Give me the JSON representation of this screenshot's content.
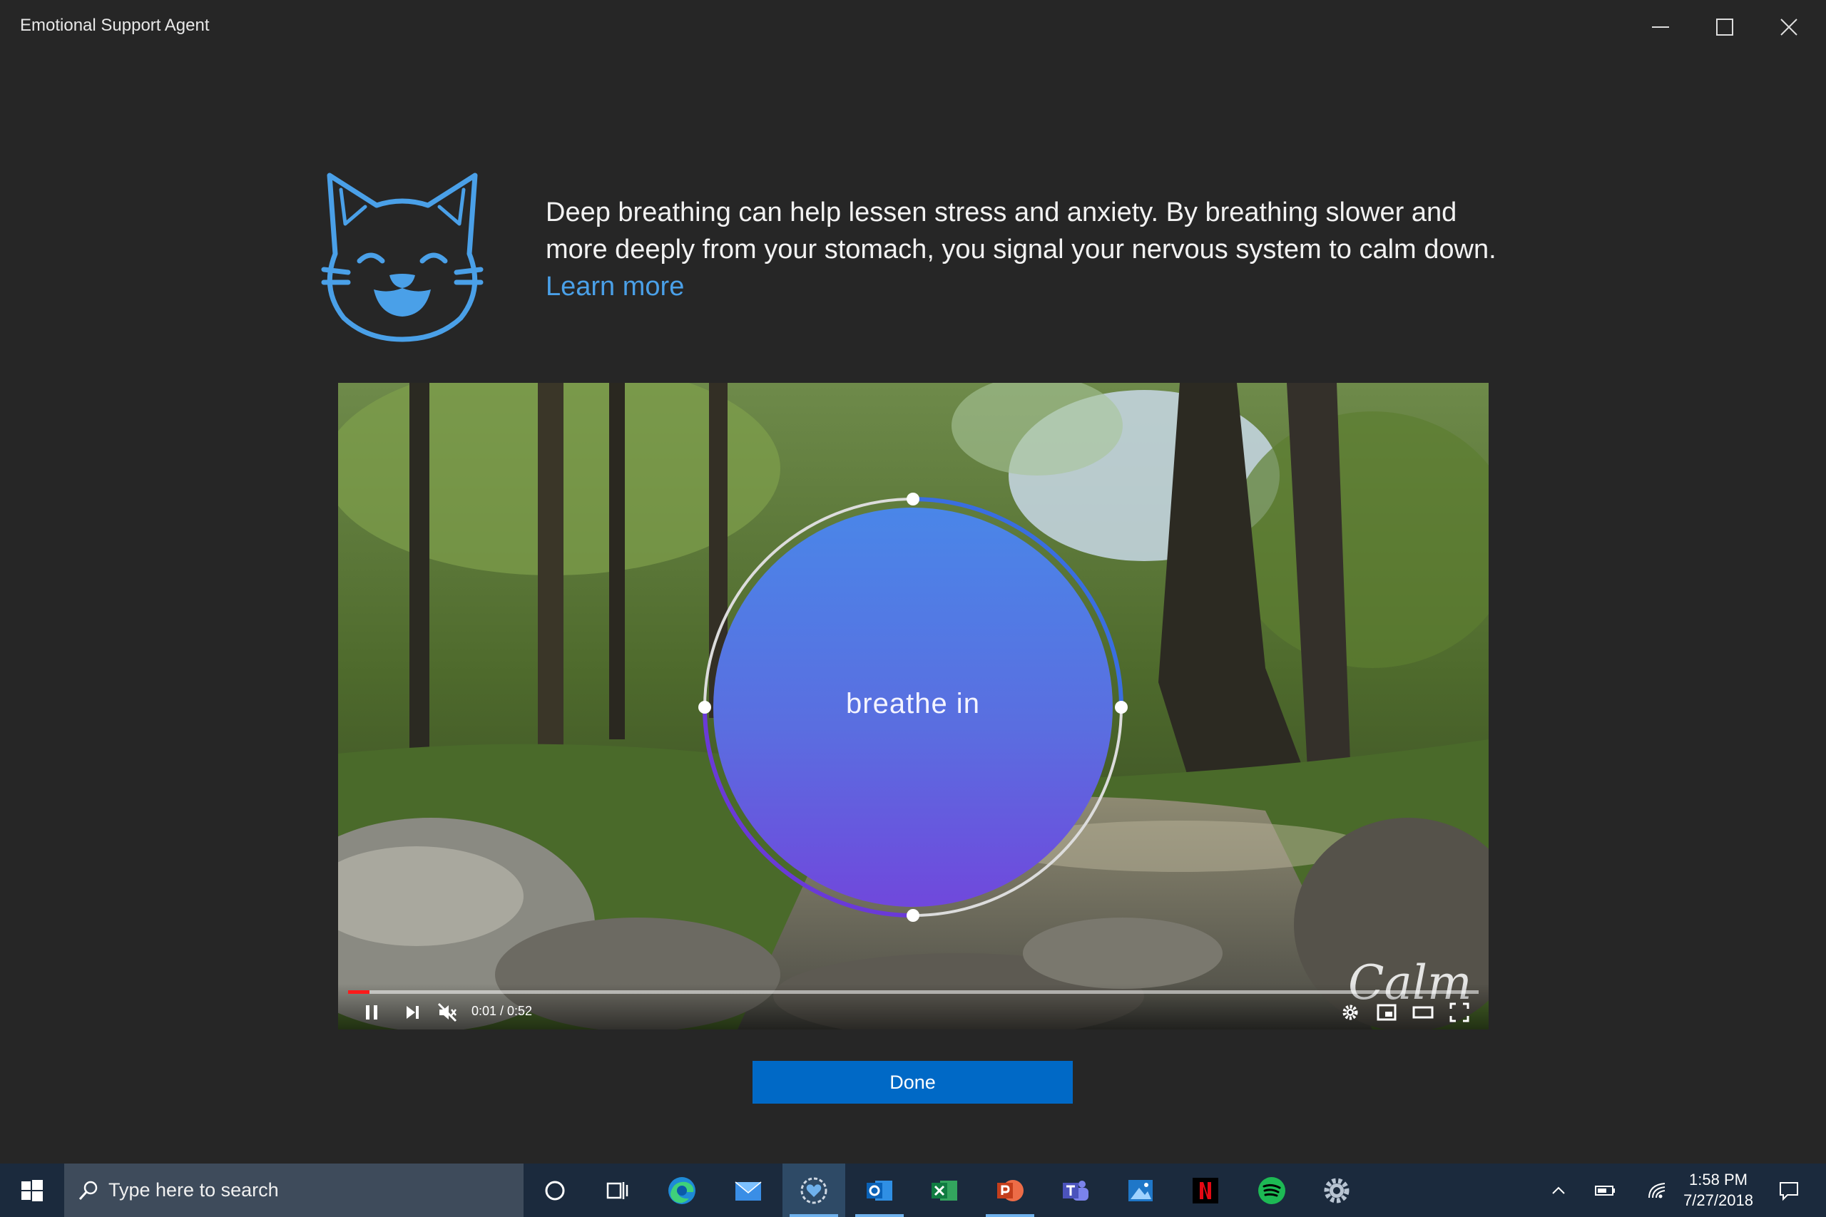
{
  "window": {
    "title": "Emotional Support Agent"
  },
  "content": {
    "message": "Deep breathing can help lessen stress and anxiety. By breathing slower and more deeply from your stomach, you signal your nervous system to calm down.",
    "learn_more": "Learn more",
    "avatar_icon": "cat-face-icon",
    "accent_color": "#4aa0e8"
  },
  "video": {
    "overlay_text": "breathe in",
    "watermark": "Calm",
    "time": "0:01 / 0:52",
    "progress": 0.019,
    "muted": true,
    "controls": [
      "pause-icon",
      "next-icon",
      "mute-icon",
      "settings-icon",
      "miniplayer-icon",
      "theater-icon",
      "fullscreen-icon"
    ]
  },
  "done_button": {
    "label": "Done",
    "color": "#0069c6"
  },
  "taskbar": {
    "search_placeholder": "Type here to search",
    "apps": [
      "cortana-icon",
      "task-view-icon",
      "edge-icon",
      "mail-icon",
      "emotional-support-app-icon",
      "outlook-icon",
      "excel-icon",
      "powerpoint-icon",
      "teams-icon",
      "photos-icon",
      "netflix-icon",
      "spotify-icon",
      "settings-icon"
    ],
    "clock_time": "1:58 PM",
    "clock_date": "7/27/2018"
  }
}
